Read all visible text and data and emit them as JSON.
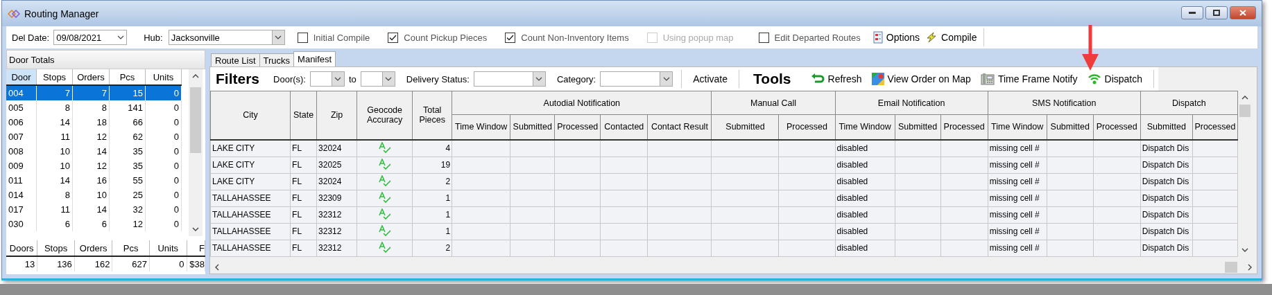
{
  "window": {
    "title": "Routing Manager"
  },
  "toolbar": {
    "del_date": {
      "label": "Del Date:",
      "value": "09/08/2021"
    },
    "hub": {
      "label": "Hub:",
      "value": "Jacksonville"
    },
    "checkboxes": [
      {
        "label": "Initial Compile",
        "checked": false,
        "disabled": false
      },
      {
        "label": "Count Pickup Pieces",
        "checked": true,
        "disabled": false
      },
      {
        "label": "Count Non-Inventory Items",
        "checked": true,
        "disabled": false
      },
      {
        "label": "Using popup map",
        "checked": false,
        "disabled": true
      },
      {
        "label": "Edit Departed Routes",
        "checked": false,
        "disabled": false
      }
    ],
    "buttons": [
      {
        "label": "Options",
        "kind": "options"
      },
      {
        "label": "Compile",
        "kind": "compile"
      }
    ]
  },
  "door_totals": {
    "title": "Door Totals",
    "columns": [
      "Door",
      "Stops",
      "Orders",
      "Pcs",
      "Units"
    ],
    "rows": [
      {
        "cells": [
          "004",
          "7",
          "7",
          "15",
          "0"
        ],
        "selected": true
      },
      {
        "cells": [
          "005",
          "8",
          "8",
          "141",
          "0"
        ],
        "selected": false
      },
      {
        "cells": [
          "006",
          "14",
          "18",
          "66",
          "0"
        ],
        "selected": false
      },
      {
        "cells": [
          "007",
          "11",
          "12",
          "62",
          "0"
        ],
        "selected": false
      },
      {
        "cells": [
          "008",
          "10",
          "14",
          "35",
          "0"
        ],
        "selected": false
      },
      {
        "cells": [
          "009",
          "10",
          "12",
          "35",
          "0"
        ],
        "selected": false
      },
      {
        "cells": [
          "011",
          "14",
          "16",
          "55",
          "0"
        ],
        "selected": false
      },
      {
        "cells": [
          "014",
          "8",
          "10",
          "25",
          "0"
        ],
        "selected": false
      },
      {
        "cells": [
          "017",
          "11",
          "14",
          "32",
          "0"
        ],
        "selected": false
      },
      {
        "cells": [
          "030",
          "6",
          "6",
          "12",
          "0"
        ],
        "selected": false
      }
    ],
    "totals": {
      "columns": [
        "Doors",
        "Stops",
        "Orders",
        "Pcs",
        "Units",
        "F"
      ],
      "values": [
        "13",
        "136",
        "162",
        "627",
        "0",
        "$38"
      ]
    }
  },
  "tabs": [
    {
      "label": "Route List",
      "selected": false
    },
    {
      "label": "Trucks",
      "selected": false
    },
    {
      "label": "Manifest",
      "selected": true
    }
  ],
  "filters": {
    "title": "Filters",
    "door_label": "Door(s):",
    "to_label": "to",
    "status_label": "Delivery Status:",
    "category_label": "Category:",
    "activate": "Activate"
  },
  "tools": {
    "title": "Tools",
    "buttons": [
      {
        "label": "Refresh",
        "kind": "refresh"
      },
      {
        "label": "View Order on Map",
        "kind": "map"
      },
      {
        "label": "Time Frame Notify",
        "kind": "phone"
      },
      {
        "label": "Dispatch",
        "kind": "dispatch"
      }
    ]
  },
  "table": {
    "columns": [
      "City",
      "State",
      "Zip",
      "Geocode Accuracy",
      "Total Pieces"
    ],
    "groups": [
      {
        "label": "Autodial Notification",
        "columns": [
          "Time Window",
          "Submitted",
          "Processed",
          "Contacted",
          "Contact Result"
        ]
      },
      {
        "label": "Manual Call",
        "columns": [
          "Submitted",
          "Processed"
        ]
      },
      {
        "label": "Email Notification",
        "columns": [
          "Time Window",
          "Submitted",
          "Processed"
        ]
      },
      {
        "label": "SMS Notification",
        "columns": [
          "Time Window",
          "Submitted",
          "Processed"
        ]
      },
      {
        "label": "Dispatch",
        "columns": [
          "Submitted",
          "Processed"
        ]
      }
    ],
    "rows": [
      {
        "city": "LAKE CITY",
        "state": "FL",
        "zip": "32024",
        "kind": "verified",
        "total_pieces": "4",
        "email_time_window": "disabled",
        "sms_time_window": "missing cell #",
        "dispatch_submitted": "Dispatch Dis"
      },
      {
        "city": "LAKE CITY",
        "state": "FL",
        "zip": "32025",
        "kind": "verified",
        "total_pieces": "19",
        "email_time_window": "disabled",
        "sms_time_window": "missing cell #",
        "dispatch_submitted": "Dispatch Dis"
      },
      {
        "city": "LAKE CITY",
        "state": "FL",
        "zip": "32024",
        "kind": "verified",
        "total_pieces": "2",
        "email_time_window": "disabled",
        "sms_time_window": "missing cell #",
        "dispatch_submitted": "Dispatch Dis"
      },
      {
        "city": "TALLAHASSEE",
        "state": "FL",
        "zip": "32309",
        "kind": "verified",
        "total_pieces": "1",
        "email_time_window": "disabled",
        "sms_time_window": "missing cell #",
        "dispatch_submitted": "Dispatch Dis"
      },
      {
        "city": "TALLAHASSEE",
        "state": "FL",
        "zip": "32312",
        "kind": "verified",
        "total_pieces": "1",
        "email_time_window": "disabled",
        "sms_time_window": "missing cell #",
        "dispatch_submitted": "Dispatch Dis"
      },
      {
        "city": "TALLAHASSEE",
        "state": "FL",
        "zip": "32312",
        "kind": "verified",
        "total_pieces": "1",
        "email_time_window": "disabled",
        "sms_time_window": "missing cell #",
        "dispatch_submitted": "Dispatch Dis"
      },
      {
        "city": "TALLAHASSEE",
        "state": "FL",
        "zip": "32312",
        "kind": "verified",
        "total_pieces": "2",
        "email_time_window": "disabled",
        "sms_time_window": "missing cell #",
        "dispatch_submitted": "Dispatch Dis"
      }
    ]
  },
  "annotations": [
    {
      "kind": "arrow"
    }
  ]
}
